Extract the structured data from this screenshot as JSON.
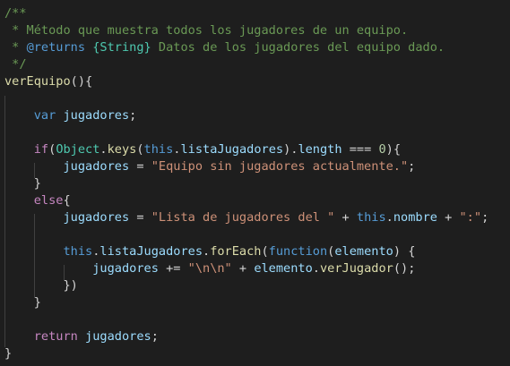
{
  "editor": {
    "language": "javascript",
    "theme": "dark",
    "colors": {
      "background": "#1e1e1e",
      "comment": "#6a9955",
      "keyword": "#569cd6",
      "control": "#c586c0",
      "class": "#4ec9b0",
      "function": "#dcdcaa",
      "variable": "#9cdcfe",
      "string": "#ce9178",
      "number": "#b5cea8",
      "plain": "#d4d4d4"
    },
    "lines": [
      [
        {
          "t": "/**",
          "c": "comment"
        }
      ],
      [
        {
          "t": " * Método que muestra todos los jugadores de un equipo.",
          "c": "comment"
        }
      ],
      [
        {
          "t": " * ",
          "c": "comment"
        },
        {
          "t": "@returns",
          "c": "keyword"
        },
        {
          "t": " ",
          "c": "comment"
        },
        {
          "t": "{String}",
          "c": "class"
        },
        {
          "t": " Datos de los jugadores del equipo dado.",
          "c": "comment"
        }
      ],
      [
        {
          "t": " */",
          "c": "comment"
        }
      ],
      [
        {
          "t": "verEquipo",
          "c": "function"
        },
        {
          "t": "(){",
          "c": "plain"
        }
      ],
      [],
      [
        {
          "t": "    ",
          "c": "plain"
        },
        {
          "t": "var",
          "c": "keyword"
        },
        {
          "t": " ",
          "c": "plain"
        },
        {
          "t": "jugadores",
          "c": "variable"
        },
        {
          "t": ";",
          "c": "plain"
        }
      ],
      [],
      [
        {
          "t": "    ",
          "c": "plain"
        },
        {
          "t": "if",
          "c": "control"
        },
        {
          "t": "(",
          "c": "plain"
        },
        {
          "t": "Object",
          "c": "class"
        },
        {
          "t": ".",
          "c": "plain"
        },
        {
          "t": "keys",
          "c": "function"
        },
        {
          "t": "(",
          "c": "plain"
        },
        {
          "t": "this",
          "c": "keyword"
        },
        {
          "t": ".",
          "c": "plain"
        },
        {
          "t": "listaJugadores",
          "c": "variable"
        },
        {
          "t": ").",
          "c": "plain"
        },
        {
          "t": "length",
          "c": "variable"
        },
        {
          "t": " === ",
          "c": "plain"
        },
        {
          "t": "0",
          "c": "number"
        },
        {
          "t": "){",
          "c": "plain"
        }
      ],
      [
        {
          "t": "        ",
          "c": "plain"
        },
        {
          "t": "jugadores",
          "c": "variable"
        },
        {
          "t": " = ",
          "c": "plain"
        },
        {
          "t": "\"Equipo sin jugadores actualmente.\"",
          "c": "string"
        },
        {
          "t": ";",
          "c": "plain"
        }
      ],
      [
        {
          "t": "    }",
          "c": "plain"
        }
      ],
      [
        {
          "t": "    ",
          "c": "plain"
        },
        {
          "t": "else",
          "c": "control"
        },
        {
          "t": "{",
          "c": "plain"
        }
      ],
      [
        {
          "t": "        ",
          "c": "plain"
        },
        {
          "t": "jugadores",
          "c": "variable"
        },
        {
          "t": " = ",
          "c": "plain"
        },
        {
          "t": "\"Lista de jugadores del \"",
          "c": "string"
        },
        {
          "t": " + ",
          "c": "plain"
        },
        {
          "t": "this",
          "c": "keyword"
        },
        {
          "t": ".",
          "c": "plain"
        },
        {
          "t": "nombre",
          "c": "variable"
        },
        {
          "t": " + ",
          "c": "plain"
        },
        {
          "t": "\":\"",
          "c": "string"
        },
        {
          "t": ";",
          "c": "plain"
        }
      ],
      [],
      [
        {
          "t": "        ",
          "c": "plain"
        },
        {
          "t": "this",
          "c": "keyword"
        },
        {
          "t": ".",
          "c": "plain"
        },
        {
          "t": "listaJugadores",
          "c": "variable"
        },
        {
          "t": ".",
          "c": "plain"
        },
        {
          "t": "forEach",
          "c": "function"
        },
        {
          "t": "(",
          "c": "plain"
        },
        {
          "t": "function",
          "c": "keyword"
        },
        {
          "t": "(",
          "c": "plain"
        },
        {
          "t": "elemento",
          "c": "variable"
        },
        {
          "t": ") {",
          "c": "plain"
        }
      ],
      [
        {
          "t": "            ",
          "c": "plain"
        },
        {
          "t": "jugadores",
          "c": "variable"
        },
        {
          "t": " += ",
          "c": "plain"
        },
        {
          "t": "\"\\n\\n\"",
          "c": "string"
        },
        {
          "t": " + ",
          "c": "plain"
        },
        {
          "t": "elemento",
          "c": "variable"
        },
        {
          "t": ".",
          "c": "plain"
        },
        {
          "t": "verJugador",
          "c": "function"
        },
        {
          "t": "();",
          "c": "plain"
        }
      ],
      [
        {
          "t": "        })",
          "c": "plain"
        }
      ],
      [
        {
          "t": "    }",
          "c": "plain"
        }
      ],
      [],
      [
        {
          "t": "    ",
          "c": "plain"
        },
        {
          "t": "return",
          "c": "control"
        },
        {
          "t": " ",
          "c": "plain"
        },
        {
          "t": "jugadores",
          "c": "variable"
        },
        {
          "t": ";",
          "c": "plain"
        }
      ],
      [
        {
          "t": "}",
          "c": "plain"
        }
      ]
    ]
  }
}
